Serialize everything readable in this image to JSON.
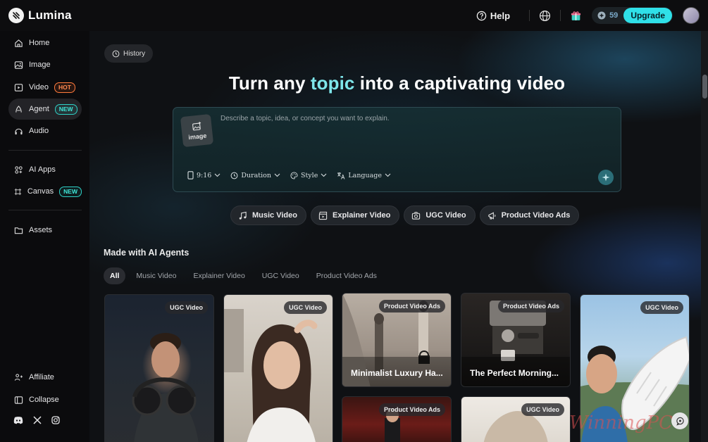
{
  "app": {
    "name": "Lumina"
  },
  "topbar": {
    "help_label": "Help",
    "credits": "59",
    "upgrade_label": "Upgrade",
    "icons": [
      "help-icon",
      "globe-icon",
      "gift-icon",
      "credit-icon",
      "avatar"
    ]
  },
  "sidebar": {
    "items": [
      {
        "label": "Home",
        "icon": "home-icon"
      },
      {
        "label": "Image",
        "icon": "image-icon"
      },
      {
        "label": "Video",
        "icon": "video-icon",
        "badge": "HOT"
      },
      {
        "label": "Agent",
        "icon": "agent-icon",
        "badge": "NEW",
        "active": true
      },
      {
        "label": "Audio",
        "icon": "audio-icon"
      },
      {
        "label": "AI Apps",
        "icon": "apps-icon"
      },
      {
        "label": "Canvas",
        "icon": "canvas-icon",
        "badge": "NEW"
      },
      {
        "label": "Assets",
        "icon": "folder-icon"
      }
    ],
    "bottom": [
      {
        "label": "Affiliate",
        "icon": "affiliate-icon"
      },
      {
        "label": "Collapse",
        "icon": "collapse-icon"
      }
    ],
    "social": [
      "discord-icon",
      "x-icon",
      "instagram-icon"
    ]
  },
  "main": {
    "history_label": "History",
    "headline_pre": "Turn any ",
    "headline_hl": "topic",
    "headline_post": " into a captivating video",
    "prompt": {
      "image_label": "image",
      "placeholder": "Describe a topic, idea, or concept you want to explain.",
      "options": [
        "9:16",
        "Duration",
        "Style",
        "Language"
      ]
    },
    "types": [
      "Music Video",
      "Explainer Video",
      "UGC Video",
      "Product Video Ads"
    ],
    "section_title": "Made with AI Agents",
    "filters": [
      "All",
      "Music Video",
      "Explainer Video",
      "UGC Video",
      "Product Video Ads"
    ],
    "cards": [
      {
        "badge": "UGC Video",
        "title": ""
      },
      {
        "badge": "UGC Video",
        "title": ""
      },
      {
        "badge": "Product Video Ads",
        "title": "Minimalist Luxury Ha..."
      },
      {
        "badge": "Product Video Ads",
        "title": "The Perfect Morning..."
      },
      {
        "badge": "UGC Video",
        "title": ""
      },
      {
        "badge": "Product Video Ads",
        "title": ""
      },
      {
        "badge": "UGC Video",
        "title": ""
      }
    ],
    "watermark": "WinningPC"
  },
  "colors": {
    "accent": "#2fe0e8",
    "hot": "#ff7a3c",
    "new": "#2fd0c6"
  }
}
